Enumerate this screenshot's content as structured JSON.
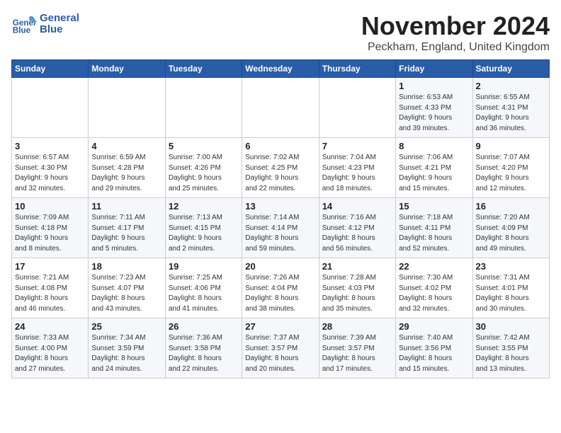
{
  "logo": {
    "line1": "General",
    "line2": "Blue"
  },
  "title": "November 2024",
  "location": "Peckham, England, United Kingdom",
  "weekdays": [
    "Sunday",
    "Monday",
    "Tuesday",
    "Wednesday",
    "Thursday",
    "Friday",
    "Saturday"
  ],
  "weeks": [
    [
      {
        "day": "",
        "info": ""
      },
      {
        "day": "",
        "info": ""
      },
      {
        "day": "",
        "info": ""
      },
      {
        "day": "",
        "info": ""
      },
      {
        "day": "",
        "info": ""
      },
      {
        "day": "1",
        "info": "Sunrise: 6:53 AM\nSunset: 4:33 PM\nDaylight: 9 hours\nand 39 minutes."
      },
      {
        "day": "2",
        "info": "Sunrise: 6:55 AM\nSunset: 4:31 PM\nDaylight: 9 hours\nand 36 minutes."
      }
    ],
    [
      {
        "day": "3",
        "info": "Sunrise: 6:57 AM\nSunset: 4:30 PM\nDaylight: 9 hours\nand 32 minutes."
      },
      {
        "day": "4",
        "info": "Sunrise: 6:59 AM\nSunset: 4:28 PM\nDaylight: 9 hours\nand 29 minutes."
      },
      {
        "day": "5",
        "info": "Sunrise: 7:00 AM\nSunset: 4:26 PM\nDaylight: 9 hours\nand 25 minutes."
      },
      {
        "day": "6",
        "info": "Sunrise: 7:02 AM\nSunset: 4:25 PM\nDaylight: 9 hours\nand 22 minutes."
      },
      {
        "day": "7",
        "info": "Sunrise: 7:04 AM\nSunset: 4:23 PM\nDaylight: 9 hours\nand 18 minutes."
      },
      {
        "day": "8",
        "info": "Sunrise: 7:06 AM\nSunset: 4:21 PM\nDaylight: 9 hours\nand 15 minutes."
      },
      {
        "day": "9",
        "info": "Sunrise: 7:07 AM\nSunset: 4:20 PM\nDaylight: 9 hours\nand 12 minutes."
      }
    ],
    [
      {
        "day": "10",
        "info": "Sunrise: 7:09 AM\nSunset: 4:18 PM\nDaylight: 9 hours\nand 8 minutes."
      },
      {
        "day": "11",
        "info": "Sunrise: 7:11 AM\nSunset: 4:17 PM\nDaylight: 9 hours\nand 5 minutes."
      },
      {
        "day": "12",
        "info": "Sunrise: 7:13 AM\nSunset: 4:15 PM\nDaylight: 9 hours\nand 2 minutes."
      },
      {
        "day": "13",
        "info": "Sunrise: 7:14 AM\nSunset: 4:14 PM\nDaylight: 8 hours\nand 59 minutes."
      },
      {
        "day": "14",
        "info": "Sunrise: 7:16 AM\nSunset: 4:12 PM\nDaylight: 8 hours\nand 56 minutes."
      },
      {
        "day": "15",
        "info": "Sunrise: 7:18 AM\nSunset: 4:11 PM\nDaylight: 8 hours\nand 52 minutes."
      },
      {
        "day": "16",
        "info": "Sunrise: 7:20 AM\nSunset: 4:09 PM\nDaylight: 8 hours\nand 49 minutes."
      }
    ],
    [
      {
        "day": "17",
        "info": "Sunrise: 7:21 AM\nSunset: 4:08 PM\nDaylight: 8 hours\nand 46 minutes."
      },
      {
        "day": "18",
        "info": "Sunrise: 7:23 AM\nSunset: 4:07 PM\nDaylight: 8 hours\nand 43 minutes."
      },
      {
        "day": "19",
        "info": "Sunrise: 7:25 AM\nSunset: 4:06 PM\nDaylight: 8 hours\nand 41 minutes."
      },
      {
        "day": "20",
        "info": "Sunrise: 7:26 AM\nSunset: 4:04 PM\nDaylight: 8 hours\nand 38 minutes."
      },
      {
        "day": "21",
        "info": "Sunrise: 7:28 AM\nSunset: 4:03 PM\nDaylight: 8 hours\nand 35 minutes."
      },
      {
        "day": "22",
        "info": "Sunrise: 7:30 AM\nSunset: 4:02 PM\nDaylight: 8 hours\nand 32 minutes."
      },
      {
        "day": "23",
        "info": "Sunrise: 7:31 AM\nSunset: 4:01 PM\nDaylight: 8 hours\nand 30 minutes."
      }
    ],
    [
      {
        "day": "24",
        "info": "Sunrise: 7:33 AM\nSunset: 4:00 PM\nDaylight: 8 hours\nand 27 minutes."
      },
      {
        "day": "25",
        "info": "Sunrise: 7:34 AM\nSunset: 3:59 PM\nDaylight: 8 hours\nand 24 minutes."
      },
      {
        "day": "26",
        "info": "Sunrise: 7:36 AM\nSunset: 3:58 PM\nDaylight: 8 hours\nand 22 minutes."
      },
      {
        "day": "27",
        "info": "Sunrise: 7:37 AM\nSunset: 3:57 PM\nDaylight: 8 hours\nand 20 minutes."
      },
      {
        "day": "28",
        "info": "Sunrise: 7:39 AM\nSunset: 3:57 PM\nDaylight: 8 hours\nand 17 minutes."
      },
      {
        "day": "29",
        "info": "Sunrise: 7:40 AM\nSunset: 3:56 PM\nDaylight: 8 hours\nand 15 minutes."
      },
      {
        "day": "30",
        "info": "Sunrise: 7:42 AM\nSunset: 3:55 PM\nDaylight: 8 hours\nand 13 minutes."
      }
    ]
  ]
}
